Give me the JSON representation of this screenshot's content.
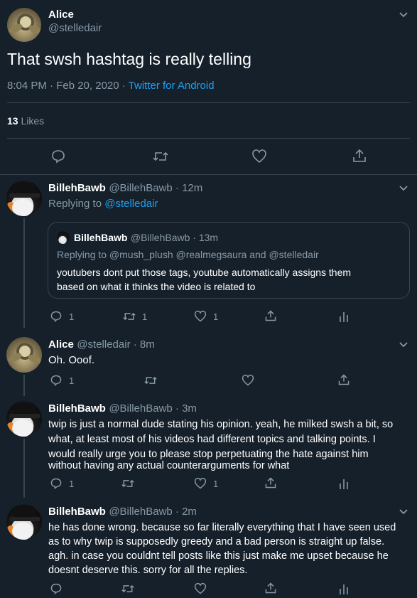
{
  "main_tweet": {
    "author_name": "Alice",
    "author_handle": "@stelledair",
    "text": "That swsh hashtag is really telling",
    "time_date": "8:04 PM · Feb 20, 2020 · ",
    "source": "Twitter for Android",
    "likes_count": "13",
    "likes_label": " Likes"
  },
  "replies": [
    {
      "name": "BillehBawb",
      "handle_time": "@BillehBawb · 12m",
      "replying_prefix": "Replying to ",
      "replying_to": "@stelledair",
      "quote": {
        "name": "BillehBawb",
        "handle_time": "@BillehBawb · 13m",
        "replying": "Replying to @mush_plush @realmegsaura and @stelledair",
        "text_line1": "youtubers dont put those tags, youtube automatically assigns them",
        "text_line2": "based on what it thinks the video is related to"
      },
      "reply_count": "1",
      "retweet_count": "1",
      "like_count": "1"
    },
    {
      "name": "Alice",
      "handle_time": "@stelledair · 8m",
      "text": "Oh. Ooof.",
      "reply_count": "1"
    },
    {
      "name": "BillehBawb",
      "handle_time": "@BillehBawb · 3m",
      "text_lines": [
        "twip is just a normal dude stating his opinion. yeah, he milked swsh a bit, so",
        "what, at least most of his videos had different topics and talking points. I",
        "would really urge you to please stop perpetuating the hate against him",
        "without having any actual counterarguments for what"
      ],
      "reply_count": "1",
      "like_count": "1"
    },
    {
      "name": "BillehBawb",
      "handle_time": "@BillehBawb · 2m",
      "text_lines": [
        "he has done wrong. because so far literally everything that I have seen used",
        "as to why twip is supposedly greedy and a bad person is straight up false.",
        "agh. in case you couldnt tell posts like this just make me upset because he",
        "doesnt deserve this. sorry for all the replies."
      ]
    }
  ],
  "colors": {
    "background": "#15202b",
    "muted": "#8899a6",
    "accent": "#1da1f2",
    "divider": "#38444d"
  }
}
